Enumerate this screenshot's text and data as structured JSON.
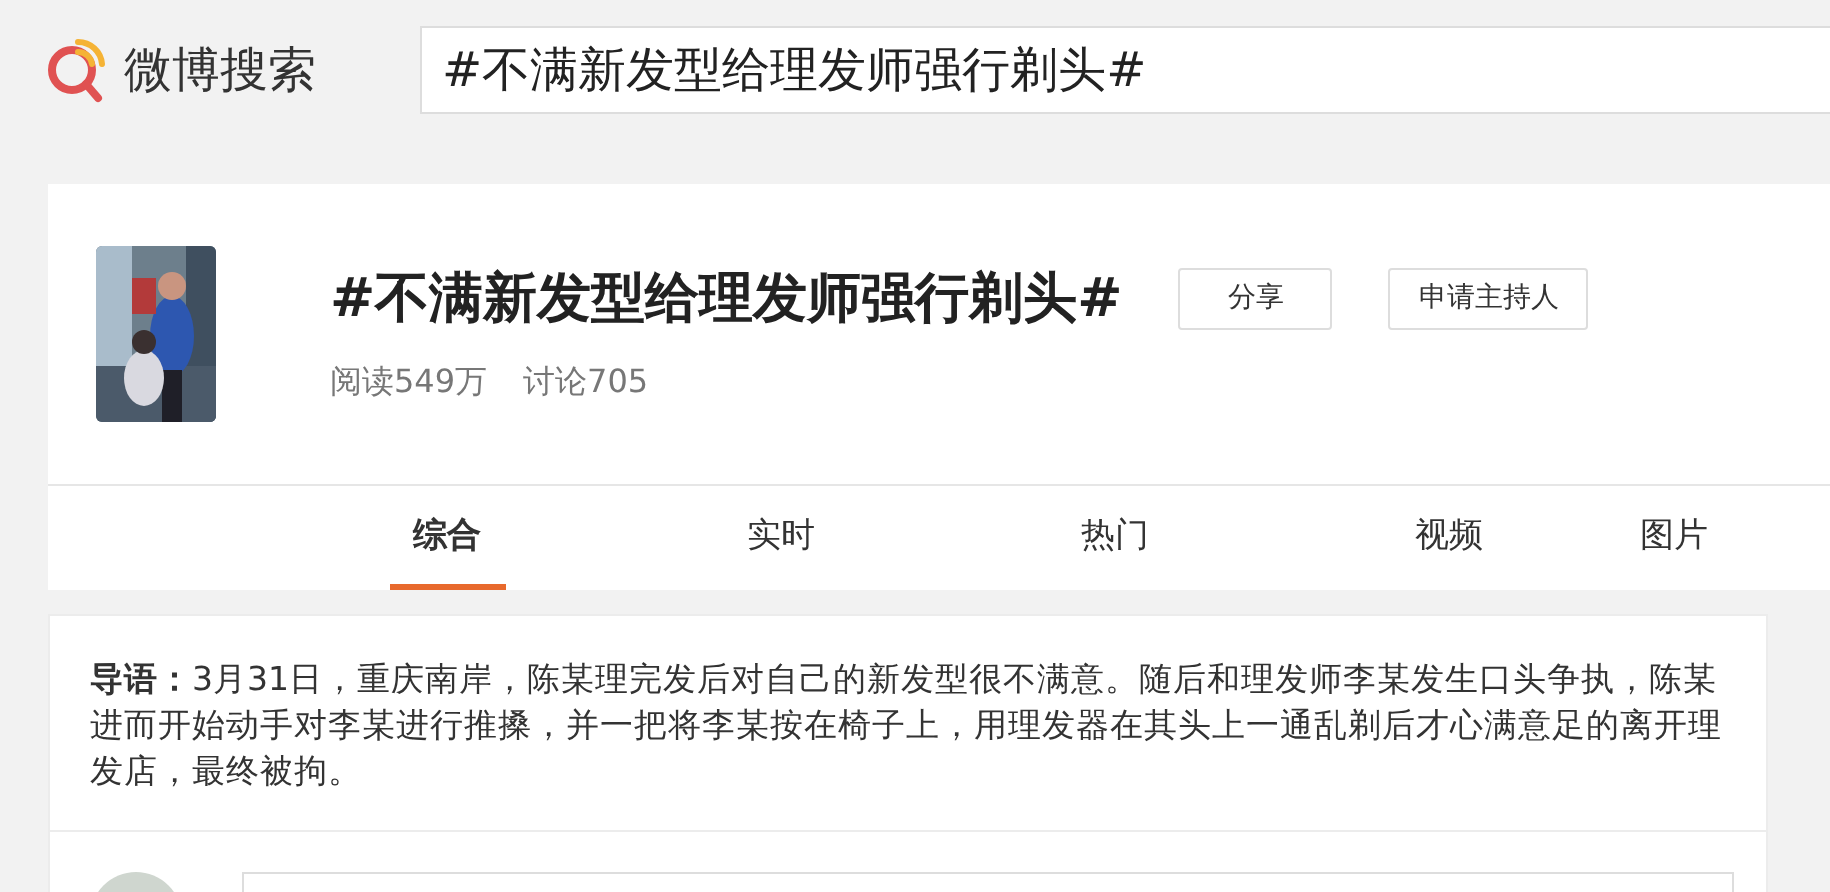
{
  "header": {
    "logo_text": "微博搜索",
    "search": {
      "value": "#不满新发型给理发师强行剃头#"
    }
  },
  "topic": {
    "title": "#不满新发型给理发师强行剃头#",
    "buttons": [
      "分享",
      "申请主持人"
    ],
    "stats": [
      "阅读549万",
      "讨论705"
    ]
  },
  "tabs": [
    {
      "label": "综合",
      "selected": true
    },
    {
      "label": "实时",
      "selected": false
    },
    {
      "label": "热门",
      "selected": false
    },
    {
      "label": "视频",
      "selected": false
    },
    {
      "label": "图片",
      "selected": false
    }
  ],
  "intro": {
    "text": "**导语：**3月31日，重庆南岸，陈某理完发后对自己的新发型很不满意。随后和理发师李某发生口头争执，陈某进而开始动手对李某进行推搡，并一把将李某按在椅子上，用理发器在其头上一通乱剃后才心满意足的离开理发店，最终被拘。"
  }
}
